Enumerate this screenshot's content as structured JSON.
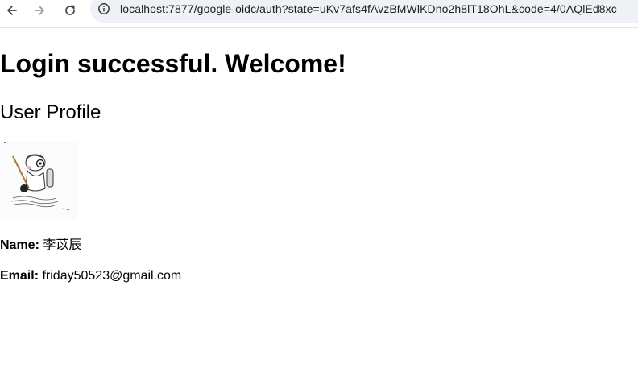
{
  "browser": {
    "url": "localhost:7877/google-oidc/auth?state=uKv7afs4fAvzBMWlKDno2h8lT18OhL&code=4/0AQlEd8xc"
  },
  "page": {
    "heading": "Login successful. Welcome!",
    "subheading": "User Profile",
    "profile": {
      "name_label": "Name:",
      "name_value": "李苡辰",
      "email_label": "Email:",
      "email_value": "friday50523@gmail.com"
    }
  },
  "icons": {
    "back": "arrow-left-icon",
    "forward": "arrow-right-icon",
    "reload": "reload-icon",
    "site_info": "info-icon"
  },
  "colors": {
    "omnibox_bg": "#eef1f6",
    "text": "#000000"
  }
}
